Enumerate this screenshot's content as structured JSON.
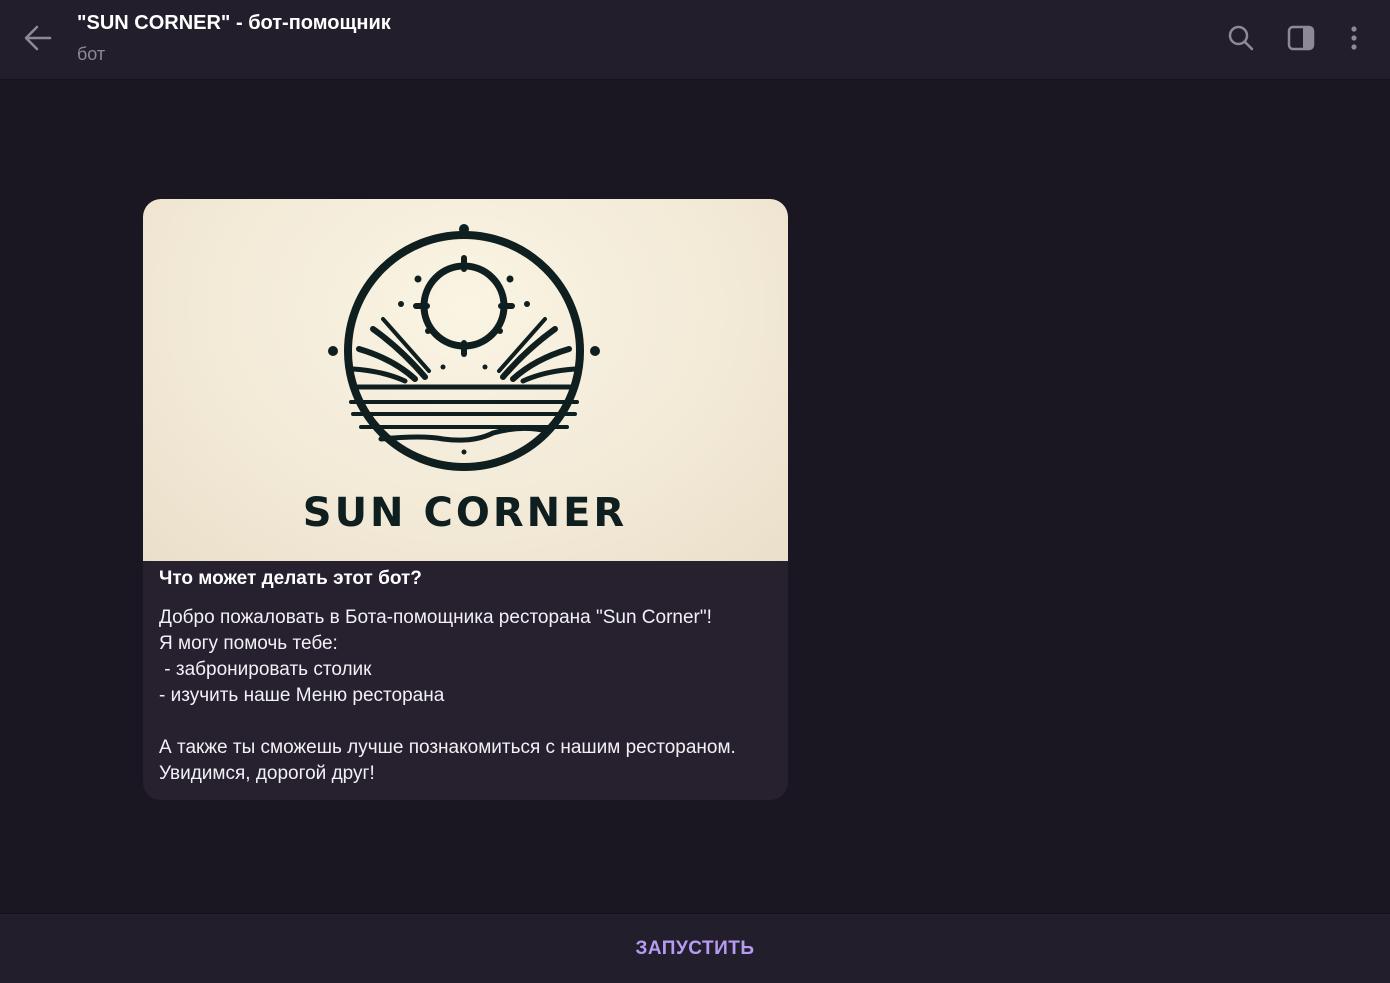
{
  "header": {
    "title": "\"SUN CORNER\" - бот-помощник",
    "subtitle": "бот",
    "icons": [
      "back-arrow-icon",
      "search-icon",
      "sidebar-panel-icon",
      "more-vertical-icon"
    ]
  },
  "message": {
    "image_logo_text": "SUN CORNER",
    "heading": "Что может делать этот бот?",
    "body": "Добро пожаловать в Бота-помощника ресторана \"Sun Corner\"!\nЯ могу помочь тебе:\n - забронировать столик\n- изучить наше Меню ресторана\n\nА также ты сможешь лучше познакомиться с нашим рестораном.\nУвидимся, дорогой друг!"
  },
  "footer": {
    "start_label": "ЗАПУСТИТЬ"
  },
  "colors": {
    "background": "#1a1722",
    "header": "#221e2b",
    "bubble": "#27212f",
    "accent": "#b79bf2",
    "subtitle": "#8d8a96"
  }
}
